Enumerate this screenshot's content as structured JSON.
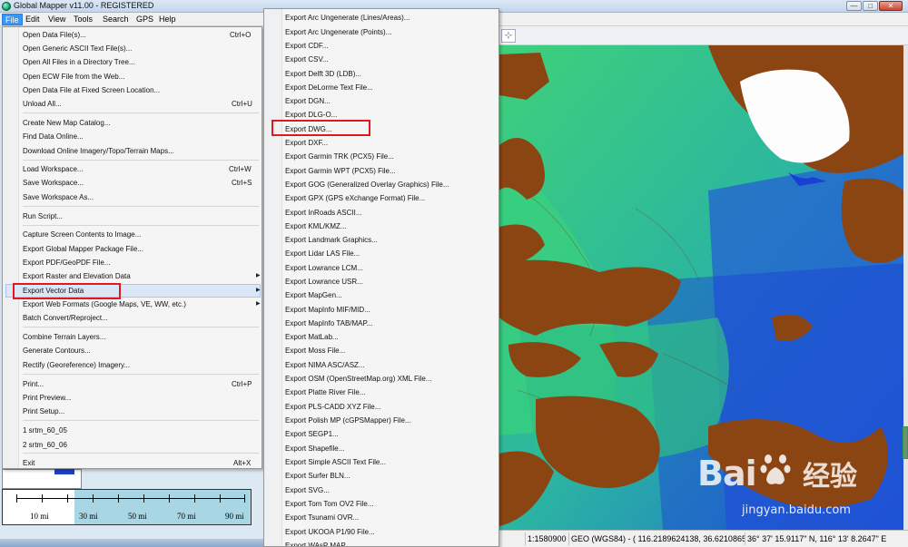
{
  "window": {
    "title": "Global Mapper v11.00 - REGISTERED",
    "buttons": [
      "—",
      "□",
      "✕"
    ]
  },
  "menubar": [
    "File",
    "Edit",
    "View",
    "Tools",
    "Search",
    "GPS",
    "Help"
  ],
  "file_menu": {
    "items": [
      {
        "label": "Open Data File(s)...",
        "shortcut": "Ctrl+O"
      },
      {
        "label": "Open Generic ASCII Text File(s)...",
        "shortcut": ""
      },
      {
        "label": "Open All Files in a Directory Tree...",
        "shortcut": ""
      },
      {
        "label": "Open ECW File from the Web...",
        "shortcut": ""
      },
      {
        "label": "Open Data File at Fixed Screen Location...",
        "shortcut": ""
      },
      {
        "label": "Unload All...",
        "shortcut": "Ctrl+U"
      },
      {
        "label": "Create New Map Catalog...",
        "shortcut": ""
      },
      {
        "label": "Find Data Online...",
        "shortcut": ""
      },
      {
        "label": "Download Online Imagery/Topo/Terrain Maps...",
        "shortcut": ""
      },
      {
        "label": "Load Workspace...",
        "shortcut": "Ctrl+W"
      },
      {
        "label": "Save Workspace...",
        "shortcut": "Ctrl+S"
      },
      {
        "label": "Save Workspace As...",
        "shortcut": ""
      },
      {
        "label": "Run Script...",
        "shortcut": ""
      },
      {
        "label": "Capture Screen Contents to Image...",
        "shortcut": ""
      },
      {
        "label": "Export Global Mapper Package File...",
        "shortcut": ""
      },
      {
        "label": "Export PDF/GeoPDF File...",
        "shortcut": ""
      },
      {
        "label": "Export Raster and Elevation Data",
        "shortcut": ""
      },
      {
        "label": "Export Vector Data",
        "shortcut": ""
      },
      {
        "label": "Export Web Formats (Google Maps, VE, WW, etc.)",
        "shortcut": ""
      },
      {
        "label": "Batch Convert/Reproject...",
        "shortcut": ""
      },
      {
        "label": "Combine Terrain Layers...",
        "shortcut": ""
      },
      {
        "label": "Generate Contours...",
        "shortcut": ""
      },
      {
        "label": "Rectify (Georeference) Imagery...",
        "shortcut": ""
      },
      {
        "label": "Print...",
        "shortcut": "Ctrl+P"
      },
      {
        "label": "Print Preview...",
        "shortcut": ""
      },
      {
        "label": "Print Setup...",
        "shortcut": ""
      },
      {
        "label": "1 srtm_60_05",
        "shortcut": ""
      },
      {
        "label": "2 srtm_60_06",
        "shortcut": ""
      },
      {
        "label": "Exit",
        "shortcut": "Alt+X"
      }
    ],
    "highlighted": "Export Vector Data"
  },
  "export_submenu": {
    "items": [
      "Export Arc Ungenerate (Lines/Areas)...",
      "Export Arc Ungenerate (Points)...",
      "Export CDF...",
      "Export CSV...",
      "Export Delft 3D (LDB)...",
      "Export DeLorme Text File...",
      "Export DGN...",
      "Export DLG-O...",
      "Export DWG...",
      "Export DXF...",
      "Export Garmin TRK (PCX5) File...",
      "Export Garmin WPT (PCX5) File...",
      "Export GOG (Generalized Overlay Graphics) File...",
      "Export GPX (GPS eXchange Format) File...",
      "Export InRoads ASCII...",
      "Export KML/KMZ...",
      "Export Landmark Graphics...",
      "Export Lidar LAS File...",
      "Export Lowrance LCM...",
      "Export Lowrance USR...",
      "Export MapGen...",
      "Export MapInfo MIF/MID...",
      "Export MapInfo TAB/MAP...",
      "Export MatLab...",
      "Export Moss File...",
      "Export NIMA ASC/ASZ...",
      "Export OSM (OpenStreetMap.org) XML File...",
      "Export Platte River File...",
      "Export PLS-CADD XYZ File...",
      "Export Polish MP (cGPSMapper) File...",
      "Export SEGP1...",
      "Export Shapefile...",
      "Export Simple ASCII Text File...",
      "Export Surfer BLN...",
      "Export SVG...",
      "Export Tom Tom OV2 File...",
      "Export Tsunami OVR...",
      "Export UKOOA P1/90 File...",
      "Export WAsP MAP..."
    ],
    "highlighted": "Export DWG..."
  },
  "scale_bar": {
    "labels": [
      "10 mi",
      "30 mi",
      "50 mi",
      "70 mi",
      "90 mi"
    ]
  },
  "status_bar": {
    "scale": "1:1580900",
    "coords": "GEO (WGS84) - ( 116.2189624138, 36.6210865866 )",
    "dms": "36° 37' 15.9117\" N, 116° 13' 8.2647\" E"
  },
  "watermark": {
    "brand": "Bai",
    "brand2": "du",
    "cn": "经验",
    "url": "jingyan.baidu.com"
  },
  "colors": {
    "menu_active": "#3399ff",
    "highlight_box": "#e0191f",
    "terrain_low": "#2f86c6",
    "terrain_mid": "#35c48a",
    "terrain_high": "#8b4513"
  }
}
